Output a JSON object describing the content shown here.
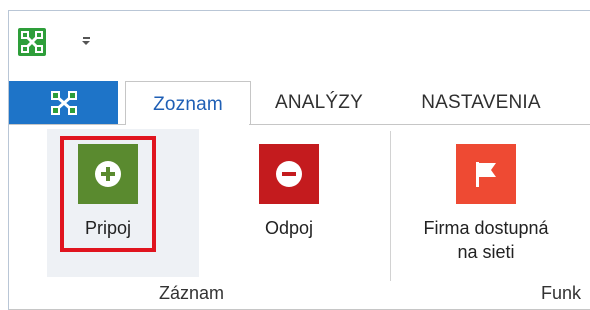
{
  "app": {
    "icon": "network-nodes-icon",
    "icon_color": "#2e9e3a"
  },
  "tabs": [
    {
      "label": "Zoznam",
      "active": true
    },
    {
      "label": "ANALÝZY",
      "active": false
    },
    {
      "label": "NASTAVENIA",
      "active": false
    }
  ],
  "ribbon": {
    "buttons": [
      {
        "label": "Pripoj",
        "icon": "plus-circle-icon",
        "color": "#5a8a2f",
        "highlighted": true
      },
      {
        "label": "Odpoj",
        "icon": "minus-circle-icon",
        "color": "#c41b1e"
      },
      {
        "label_line1": "Firma dostupná",
        "label_line2": "na sieti",
        "icon": "flag-icon",
        "color": "#ee4a33"
      }
    ],
    "groups": [
      {
        "label": "Záznam"
      },
      {
        "label": "Funk"
      }
    ]
  },
  "colors": {
    "file_tab": "#1e74c8",
    "active_tab_text": "#1f5fb5",
    "highlight": "#e0141e"
  }
}
